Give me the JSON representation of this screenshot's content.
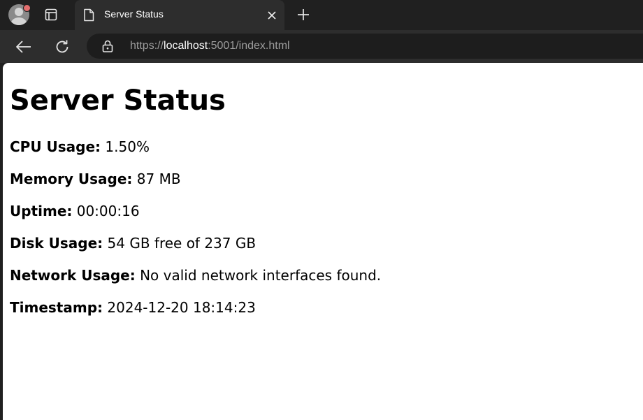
{
  "browser": {
    "tab_title": "Server Status",
    "url_scheme": "https://",
    "url_host": "localhost",
    "url_rest": ":5001/index.html"
  },
  "page": {
    "heading": "Server Status",
    "stats": [
      {
        "label": "CPU Usage:",
        "value": "1.50%"
      },
      {
        "label": "Memory Usage:",
        "value": "87 MB"
      },
      {
        "label": "Uptime:",
        "value": "00:00:16"
      },
      {
        "label": "Disk Usage:",
        "value": "54 GB free of 237 GB"
      },
      {
        "label": "Network Usage:",
        "value": "No valid network interfaces found."
      },
      {
        "label": "Timestamp:",
        "value": "2024-12-20 18:14:23"
      }
    ]
  },
  "icons": {
    "profile": "avatar-icon",
    "tab_actions": "tab-actions-icon",
    "document": "document-icon",
    "close": "close-icon",
    "new_tab": "plus-icon",
    "back": "back-arrow-icon",
    "reload": "reload-icon",
    "lock": "lock-icon"
  }
}
